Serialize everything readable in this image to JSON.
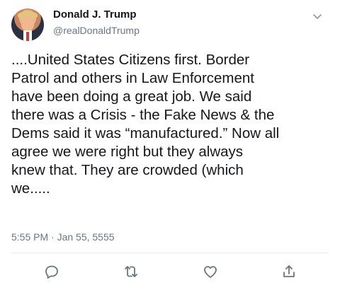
{
  "tweet": {
    "author_name": "Donald J. Trump",
    "author_handle": "@realDonaldTrump",
    "text": "....United States Citizens first. Border\nPatrol and others in Law Enforcement\nhave been doing a great job. We said\nthere was a Crisis - the Fake News & the\nDems said it was “manufactured.” Now all\nagree we were right but they always\nknew that. They are crowded (which\nwe.....",
    "timestamp": "5:55 PM · Jan 55, 5555"
  },
  "icons": {
    "menu": "chevron-down",
    "reply": "speech-bubble",
    "retweet": "retweet-arrows",
    "like": "heart",
    "share": "share-upload"
  },
  "colors": {
    "text": "#14171a",
    "secondary": "#657786",
    "divider": "#e6ecf0"
  }
}
